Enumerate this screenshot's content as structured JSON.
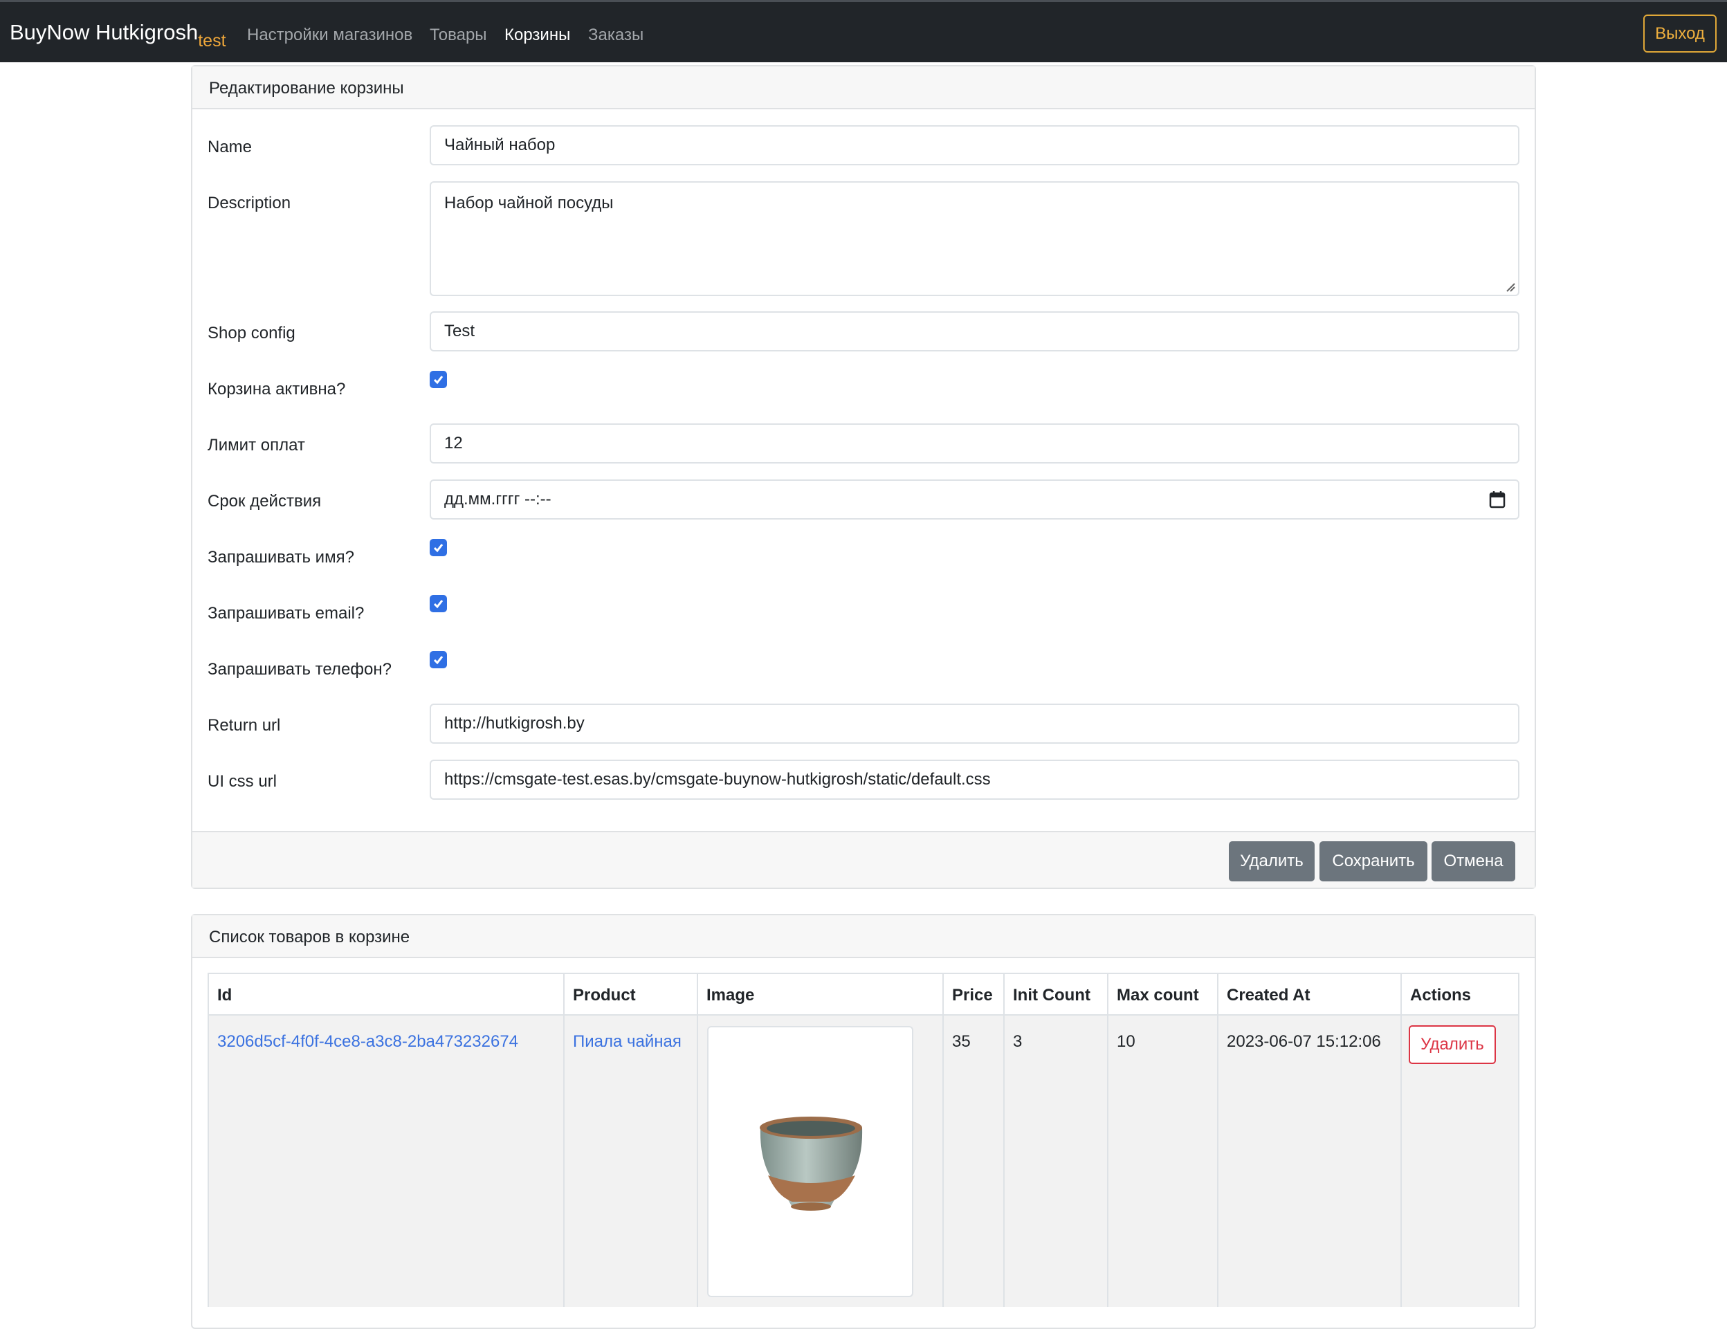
{
  "navbar": {
    "brand": "BuyNow Hutkigrosh",
    "brand_env": "test",
    "links": [
      {
        "label": "Настройки магазинов",
        "active": false
      },
      {
        "label": "Товары",
        "active": false
      },
      {
        "label": "Корзины",
        "active": true
      },
      {
        "label": "Заказы",
        "active": false
      }
    ],
    "logout_label": "Выход"
  },
  "edit_card": {
    "title": "Редактирование корзины",
    "fields": {
      "name": {
        "label": "Name",
        "value": "Чайный набор"
      },
      "description": {
        "label": "Description",
        "value": "Набор чайной посуды"
      },
      "shop_config": {
        "label": "Shop config",
        "value": "Test"
      },
      "cart_active": {
        "label": "Корзина активна?",
        "checked": true
      },
      "payment_limit": {
        "label": "Лимит оплат",
        "value": "12"
      },
      "expiry": {
        "label": "Срок действия",
        "value": "дд.мм.гггг --:--"
      },
      "ask_name": {
        "label": "Запрашивать имя?",
        "checked": true
      },
      "ask_email": {
        "label": "Запрашивать email?",
        "checked": true
      },
      "ask_phone": {
        "label": "Запрашивать телефон?",
        "checked": true
      },
      "return_url": {
        "label": "Return url",
        "value": "http://hutkigrosh.by"
      },
      "ui_css_url": {
        "label": "UI css url",
        "value": "https://cmsgate-test.esas.by/cmsgate-buynow-hutkigrosh/static/default.css"
      }
    },
    "buttons": {
      "delete": "Удалить",
      "save": "Сохранить",
      "cancel": "Отмена"
    }
  },
  "products_card": {
    "title": "Список товаров в корзине",
    "columns": [
      "Id",
      "Product",
      "Image",
      "Price",
      "Init Count",
      "Max count",
      "Created At",
      "Actions"
    ],
    "rows": [
      {
        "id": "3206d5cf-4f0f-4ce8-a3c8-2ba473232674",
        "product": "Пиала чайная",
        "image": "tea-bowl-image",
        "price": "35",
        "init_count": "3",
        "max_count": "10",
        "created_at": "2023-06-07 15:12:06",
        "action_label": "Удалить"
      }
    ]
  },
  "colors": {
    "navbar_bg": "#212529",
    "brand_env": "#f0a83a",
    "logout": "#f0b03e",
    "checkbox": "#2f6fe4",
    "link": "#3b72e0",
    "danger": "#dc3545",
    "secondary": "#6c757d"
  }
}
